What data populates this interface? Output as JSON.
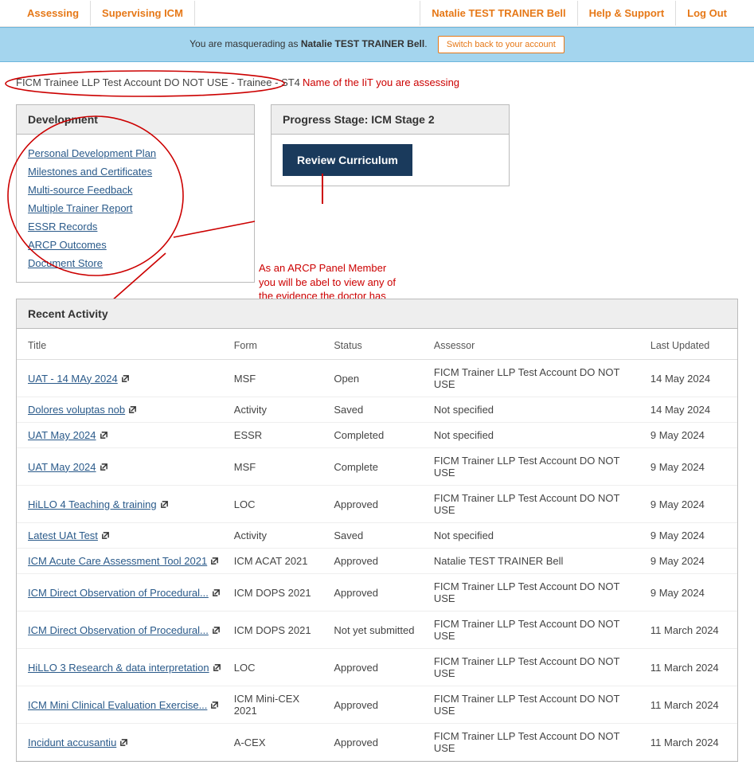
{
  "nav": {
    "left": [
      "Assessing",
      "Supervising ICM"
    ],
    "right": [
      "Natalie TEST TRAINER Bell",
      "Help & Support",
      "Log Out"
    ]
  },
  "masq": {
    "prefix": "You are masquerading as ",
    "name": "Natalie TEST TRAINER Bell",
    "suffix": ".",
    "button": "Switch back to your account"
  },
  "crumb": "FICM Trainee LLP Test Account DO NOT USE - Trainee - ST4",
  "annotations": {
    "crumb": "Name of the IiT you are assessing",
    "arcp": "As an ARCP Panel Member you will be abel to view any of the evidence the doctor has saved in these sections"
  },
  "development": {
    "title": "Development",
    "links": [
      "Personal Development Plan",
      "Milestones and Certificates",
      "Multi-source Feedback",
      "Multiple Trainer Report",
      "ESSR Records",
      "ARCP Outcomes",
      "Document Store"
    ]
  },
  "progress": {
    "title": "Progress Stage: ICM Stage 2",
    "button": "Review Curriculum"
  },
  "activity": {
    "title": "Recent Activity",
    "columns": [
      "Title",
      "Form",
      "Status",
      "Assessor",
      "Last Updated"
    ],
    "rows": [
      {
        "title": "UAT - 14 MAy 2024",
        "form": "MSF",
        "status": "Open",
        "assessor": "FICM Trainer LLP Test Account DO NOT USE",
        "updated": "14 May 2024"
      },
      {
        "title": "Dolores voluptas nob",
        "form": "Activity",
        "status": "Saved",
        "assessor": "Not specified",
        "updated": "14 May 2024"
      },
      {
        "title": "UAT May 2024",
        "form": "ESSR",
        "status": "Completed",
        "assessor": "Not specified",
        "updated": "9 May 2024"
      },
      {
        "title": "UAT May 2024",
        "form": "MSF",
        "status": "Complete",
        "assessor": "FICM Trainer LLP Test Account DO NOT USE",
        "updated": "9 May 2024"
      },
      {
        "title": "HiLLO 4 Teaching & training",
        "form": "LOC",
        "status": "Approved",
        "assessor": "FICM Trainer LLP Test Account DO NOT USE",
        "updated": "9 May 2024"
      },
      {
        "title": "Latest UAt Test",
        "form": "Activity",
        "status": "Saved",
        "assessor": "Not specified",
        "updated": "9 May 2024"
      },
      {
        "title": "ICM Acute Care Assessment Tool 2021",
        "form": "ICM ACAT 2021",
        "status": "Approved",
        "assessor": "Natalie TEST TRAINER Bell",
        "updated": "9 May 2024"
      },
      {
        "title": "ICM Direct Observation of Procedural...",
        "form": "ICM DOPS 2021",
        "status": "Approved",
        "assessor": "FICM Trainer LLP Test Account DO NOT USE",
        "updated": "9 May 2024"
      },
      {
        "title": "ICM Direct Observation of Procedural...",
        "form": "ICM DOPS 2021",
        "status": "Not yet submitted",
        "assessor": "FICM Trainer LLP Test Account DO NOT USE",
        "updated": "11 March 2024"
      },
      {
        "title": "HiLLO 3 Research & data interpretation",
        "form": "LOC",
        "status": "Approved",
        "assessor": "FICM Trainer LLP Test Account DO NOT USE",
        "updated": "11 March 2024"
      },
      {
        "title": "ICM Mini Clinical Evaluation Exercise...",
        "form": "ICM Mini-CEX 2021",
        "status": "Approved",
        "assessor": "FICM Trainer LLP Test Account DO NOT USE",
        "updated": "11 March 2024"
      },
      {
        "title": "Incidunt accusantiu",
        "form": "A-CEX",
        "status": "Approved",
        "assessor": "FICM Trainer LLP Test Account DO NOT USE",
        "updated": "11 March 2024"
      }
    ]
  }
}
